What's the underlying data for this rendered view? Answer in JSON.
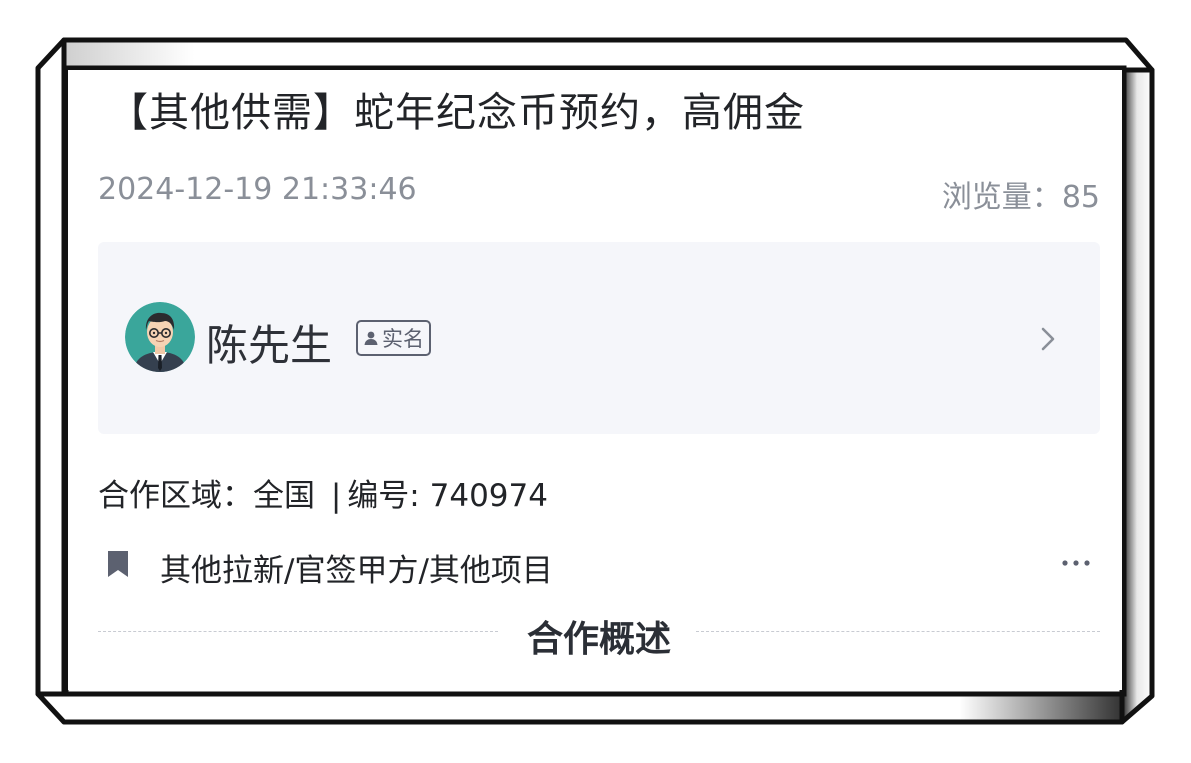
{
  "post": {
    "title": "【其他供需】蛇年纪念币预约，高佣金",
    "date": "2024-12-19 21:33:46",
    "views_label": "浏览量：",
    "views_count": "85"
  },
  "user": {
    "name": "陈先生",
    "badge_label": "实名"
  },
  "details": {
    "region_label": "合作区域：",
    "region_value": "全国",
    "separator": "|",
    "number_label": "编号:",
    "number_value": "740974"
  },
  "tags": {
    "text": "其他拉新/官签甲方/其他项目"
  },
  "section": {
    "title": "合作概述"
  },
  "icons": {
    "bookmark": "bookmark-icon",
    "more": "more-horizontal-icon",
    "chevron": "chevron-right-icon",
    "person": "person-icon"
  },
  "colors": {
    "text_primary": "#222428",
    "text_secondary": "#8a8f98",
    "panel_bg": "#f5f6fa",
    "avatar_bg": "#3aa69b"
  }
}
